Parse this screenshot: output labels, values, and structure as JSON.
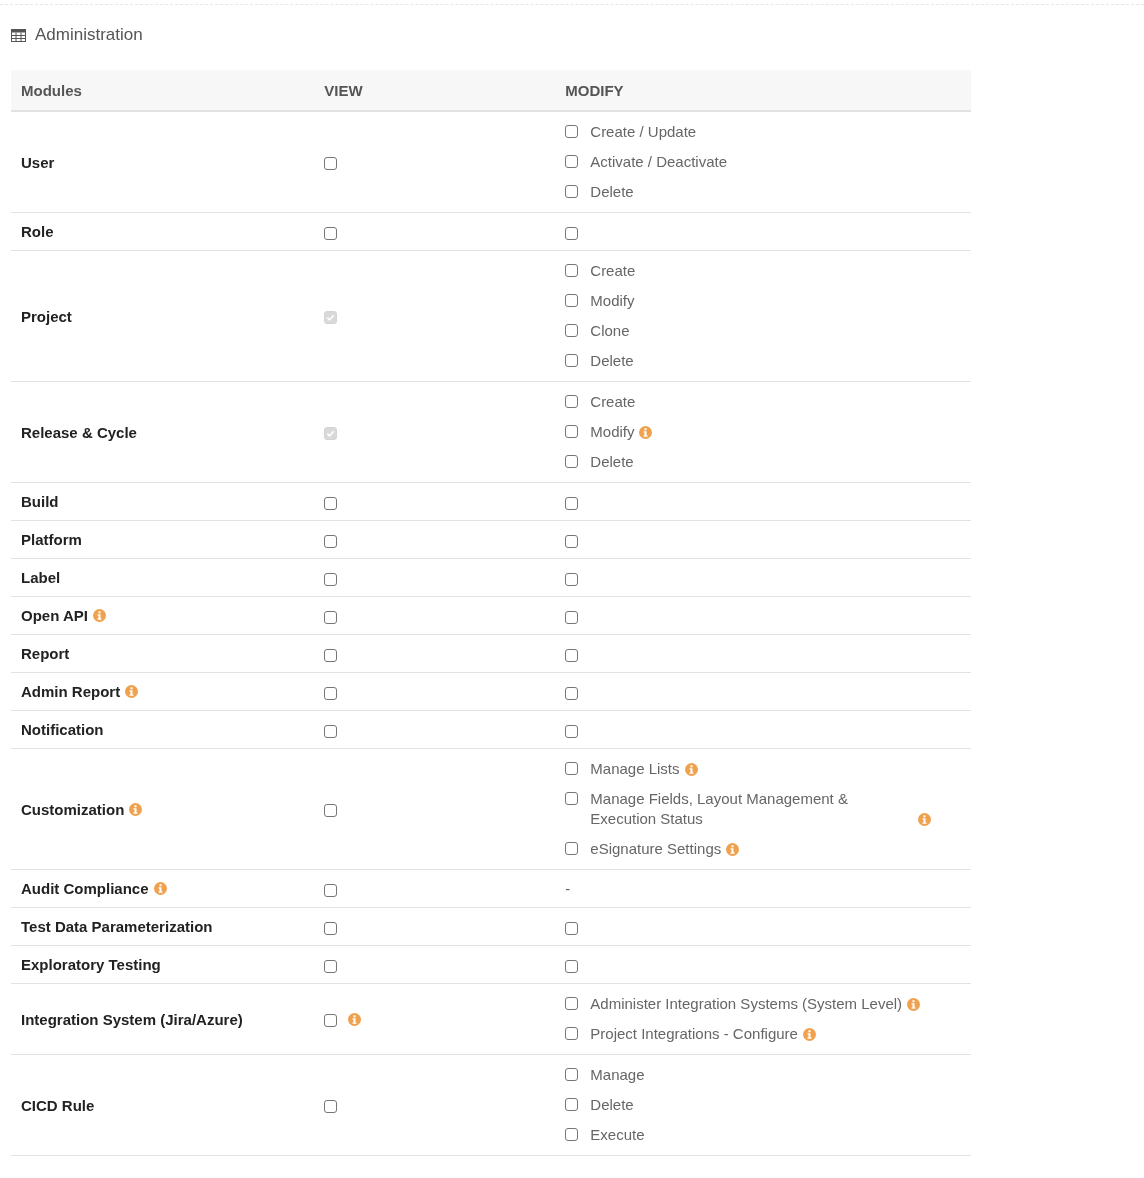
{
  "section": {
    "title": "Administration"
  },
  "columns": [
    "Modules",
    "VIEW",
    "MODIFY"
  ],
  "rows": [
    {
      "module": "User",
      "info": false,
      "view": {
        "checked": false,
        "disabled": false,
        "info": false
      },
      "modify": {
        "kind": "options",
        "options": [
          {
            "label": "Create / Update",
            "checked": false,
            "info": false
          },
          {
            "label": "Activate / Deactivate",
            "checked": false,
            "info": false
          },
          {
            "label": "Delete",
            "checked": false,
            "info": false
          }
        ]
      }
    },
    {
      "module": "Role",
      "info": false,
      "view": {
        "checked": false,
        "disabled": false,
        "info": false
      },
      "modify": {
        "kind": "single",
        "checked": false
      }
    },
    {
      "module": "Project",
      "info": false,
      "view": {
        "checked": true,
        "disabled": true,
        "info": false
      },
      "modify": {
        "kind": "options",
        "options": [
          {
            "label": "Create",
            "checked": false,
            "info": false
          },
          {
            "label": "Modify",
            "checked": false,
            "info": false
          },
          {
            "label": "Clone",
            "checked": false,
            "info": false
          },
          {
            "label": "Delete",
            "checked": false,
            "info": false
          }
        ]
      }
    },
    {
      "module": "Release & Cycle",
      "info": false,
      "view": {
        "checked": true,
        "disabled": true,
        "info": false
      },
      "modify": {
        "kind": "options",
        "options": [
          {
            "label": "Create",
            "checked": false,
            "info": false
          },
          {
            "label": "Modify",
            "checked": false,
            "info": true
          },
          {
            "label": "Delete",
            "checked": false,
            "info": false
          }
        ]
      }
    },
    {
      "module": "Build",
      "info": false,
      "view": {
        "checked": false,
        "disabled": false,
        "info": false
      },
      "modify": {
        "kind": "single",
        "checked": false
      }
    },
    {
      "module": "Platform",
      "info": false,
      "view": {
        "checked": false,
        "disabled": false,
        "info": false
      },
      "modify": {
        "kind": "single",
        "checked": false
      }
    },
    {
      "module": "Label",
      "info": false,
      "view": {
        "checked": false,
        "disabled": false,
        "info": false
      },
      "modify": {
        "kind": "single",
        "checked": false
      }
    },
    {
      "module": "Open API",
      "info": true,
      "view": {
        "checked": false,
        "disabled": false,
        "info": false
      },
      "modify": {
        "kind": "single",
        "checked": false
      }
    },
    {
      "module": "Report",
      "info": false,
      "view": {
        "checked": false,
        "disabled": false,
        "info": false
      },
      "modify": {
        "kind": "single",
        "checked": false
      }
    },
    {
      "module": "Admin Report",
      "info": true,
      "view": {
        "checked": false,
        "disabled": false,
        "info": false
      },
      "modify": {
        "kind": "single",
        "checked": false
      }
    },
    {
      "module": "Notification",
      "info": false,
      "view": {
        "checked": false,
        "disabled": false,
        "info": false
      },
      "modify": {
        "kind": "single",
        "checked": false
      }
    },
    {
      "module": "Customization",
      "info": true,
      "view": {
        "checked": false,
        "disabled": false,
        "info": false
      },
      "modify": {
        "kind": "options",
        "options": [
          {
            "label": "Manage Lists",
            "checked": false,
            "info": true
          },
          {
            "label": "Manage Fields, Layout Management & Execution Status",
            "checked": false,
            "info": true
          },
          {
            "label": "eSignature Settings",
            "checked": false,
            "info": true
          }
        ]
      }
    },
    {
      "module": "Audit Compliance",
      "info": true,
      "view": {
        "checked": false,
        "disabled": false,
        "info": false
      },
      "modify": {
        "kind": "text",
        "text": "-"
      }
    },
    {
      "module": "Test Data Parameterization",
      "info": false,
      "view": {
        "checked": false,
        "disabled": false,
        "info": false
      },
      "modify": {
        "kind": "single",
        "checked": false
      }
    },
    {
      "module": "Exploratory Testing",
      "info": false,
      "view": {
        "checked": false,
        "disabled": false,
        "info": false
      },
      "modify": {
        "kind": "single",
        "checked": false
      }
    },
    {
      "module": "Integration System (Jira/Azure)",
      "info": false,
      "view": {
        "checked": false,
        "disabled": false,
        "info": true
      },
      "modify": {
        "kind": "options",
        "options": [
          {
            "label": "Administer Integration Systems (System Level)",
            "checked": false,
            "info": true
          },
          {
            "label": "Project Integrations - Configure",
            "checked": false,
            "info": true
          }
        ]
      }
    },
    {
      "module": "CICD Rule",
      "info": false,
      "view": {
        "checked": false,
        "disabled": false,
        "info": false
      },
      "modify": {
        "kind": "options",
        "options": [
          {
            "label": "Manage",
            "checked": false,
            "info": false
          },
          {
            "label": "Delete",
            "checked": false,
            "info": false
          },
          {
            "label": "Execute",
            "checked": false,
            "info": false
          }
        ]
      }
    }
  ]
}
